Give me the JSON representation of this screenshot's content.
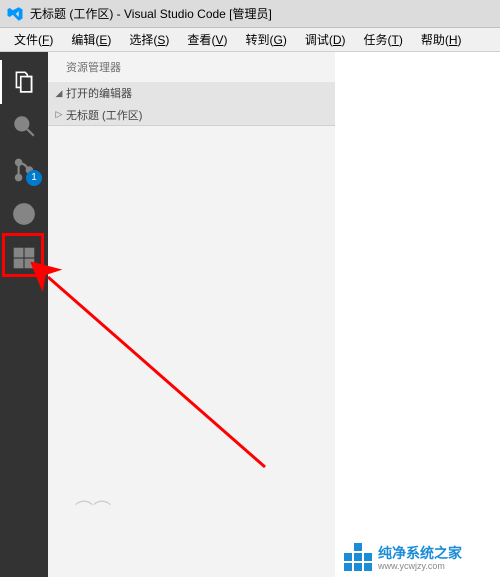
{
  "titlebar": {
    "text": "无标题 (工作区) - Visual Studio Code [管理员]"
  },
  "menubar": {
    "items": [
      {
        "label": "文件",
        "key": "F"
      },
      {
        "label": "编辑",
        "key": "E"
      },
      {
        "label": "选择",
        "key": "S"
      },
      {
        "label": "查看",
        "key": "V"
      },
      {
        "label": "转到",
        "key": "G"
      },
      {
        "label": "调试",
        "key": "D"
      },
      {
        "label": "任务",
        "key": "T"
      },
      {
        "label": "帮助",
        "key": "H"
      }
    ]
  },
  "sidebar": {
    "title": "资源管理器",
    "sections": [
      {
        "label": "打开的编辑器",
        "expanded": true
      },
      {
        "label": "无标题 (工作区)",
        "expanded": false
      }
    ]
  },
  "activitybar": {
    "scm_badge": "1"
  },
  "watermark": {
    "brand": "纯净系统之家",
    "url": "www.ycwjzy.com"
  }
}
